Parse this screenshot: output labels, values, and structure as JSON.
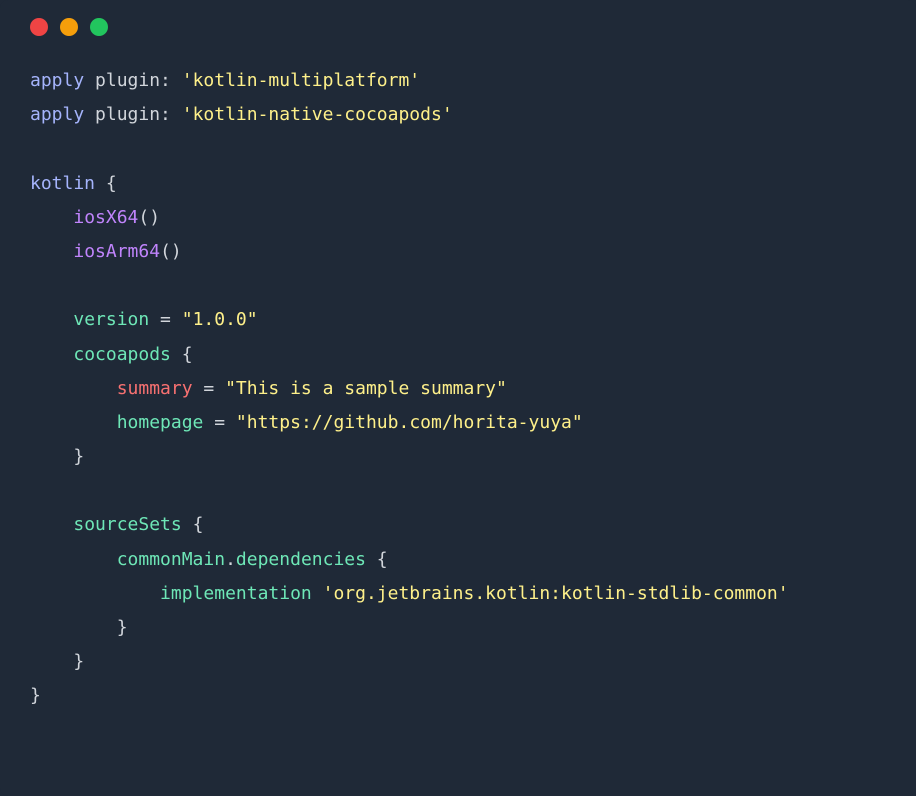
{
  "titlebar": {
    "colors": {
      "red": "#ef4444",
      "yellow": "#f59e0b",
      "green": "#22c55e"
    }
  },
  "code": {
    "line1": {
      "apply": "apply",
      "plugin": " plugin: ",
      "str": "'kotlin-multiplatform'"
    },
    "line2": {
      "apply": "apply",
      "plugin": " plugin: ",
      "str": "'kotlin-native-cocoapods'"
    },
    "line4": {
      "kotlin": "kotlin",
      "brace": " {"
    },
    "line5": {
      "indent": "    ",
      "fn": "iosX64",
      "parens": "()"
    },
    "line6": {
      "indent": "    ",
      "fn": "iosArm64",
      "parens": "()"
    },
    "line8": {
      "indent": "    ",
      "key": "version",
      "eq": " = ",
      "str": "\"1.0.0\""
    },
    "line9": {
      "indent": "    ",
      "key": "cocoapods",
      "brace": " {"
    },
    "line10": {
      "indent": "        ",
      "key": "summary",
      "eq": " = ",
      "str": "\"This is a sample summary\""
    },
    "line11": {
      "indent": "        ",
      "key": "homepage",
      "eq": " = ",
      "str": "\"https://github.com/horita-yuya\""
    },
    "line12": {
      "indent": "    ",
      "brace": "}"
    },
    "line14": {
      "indent": "    ",
      "key": "sourceSets",
      "brace": " {"
    },
    "line15": {
      "indent": "        ",
      "obj": "commonMain",
      "dot": ".",
      "prop": "dependencies",
      "brace": " {"
    },
    "line16": {
      "indent": "            ",
      "key": "implementation",
      "sp": " ",
      "str": "'org.jetbrains.kotlin:kotlin-stdlib-common'"
    },
    "line17": {
      "indent": "        ",
      "brace": "}"
    },
    "line18": {
      "indent": "    ",
      "brace": "}"
    },
    "line19": {
      "brace": "}"
    }
  }
}
